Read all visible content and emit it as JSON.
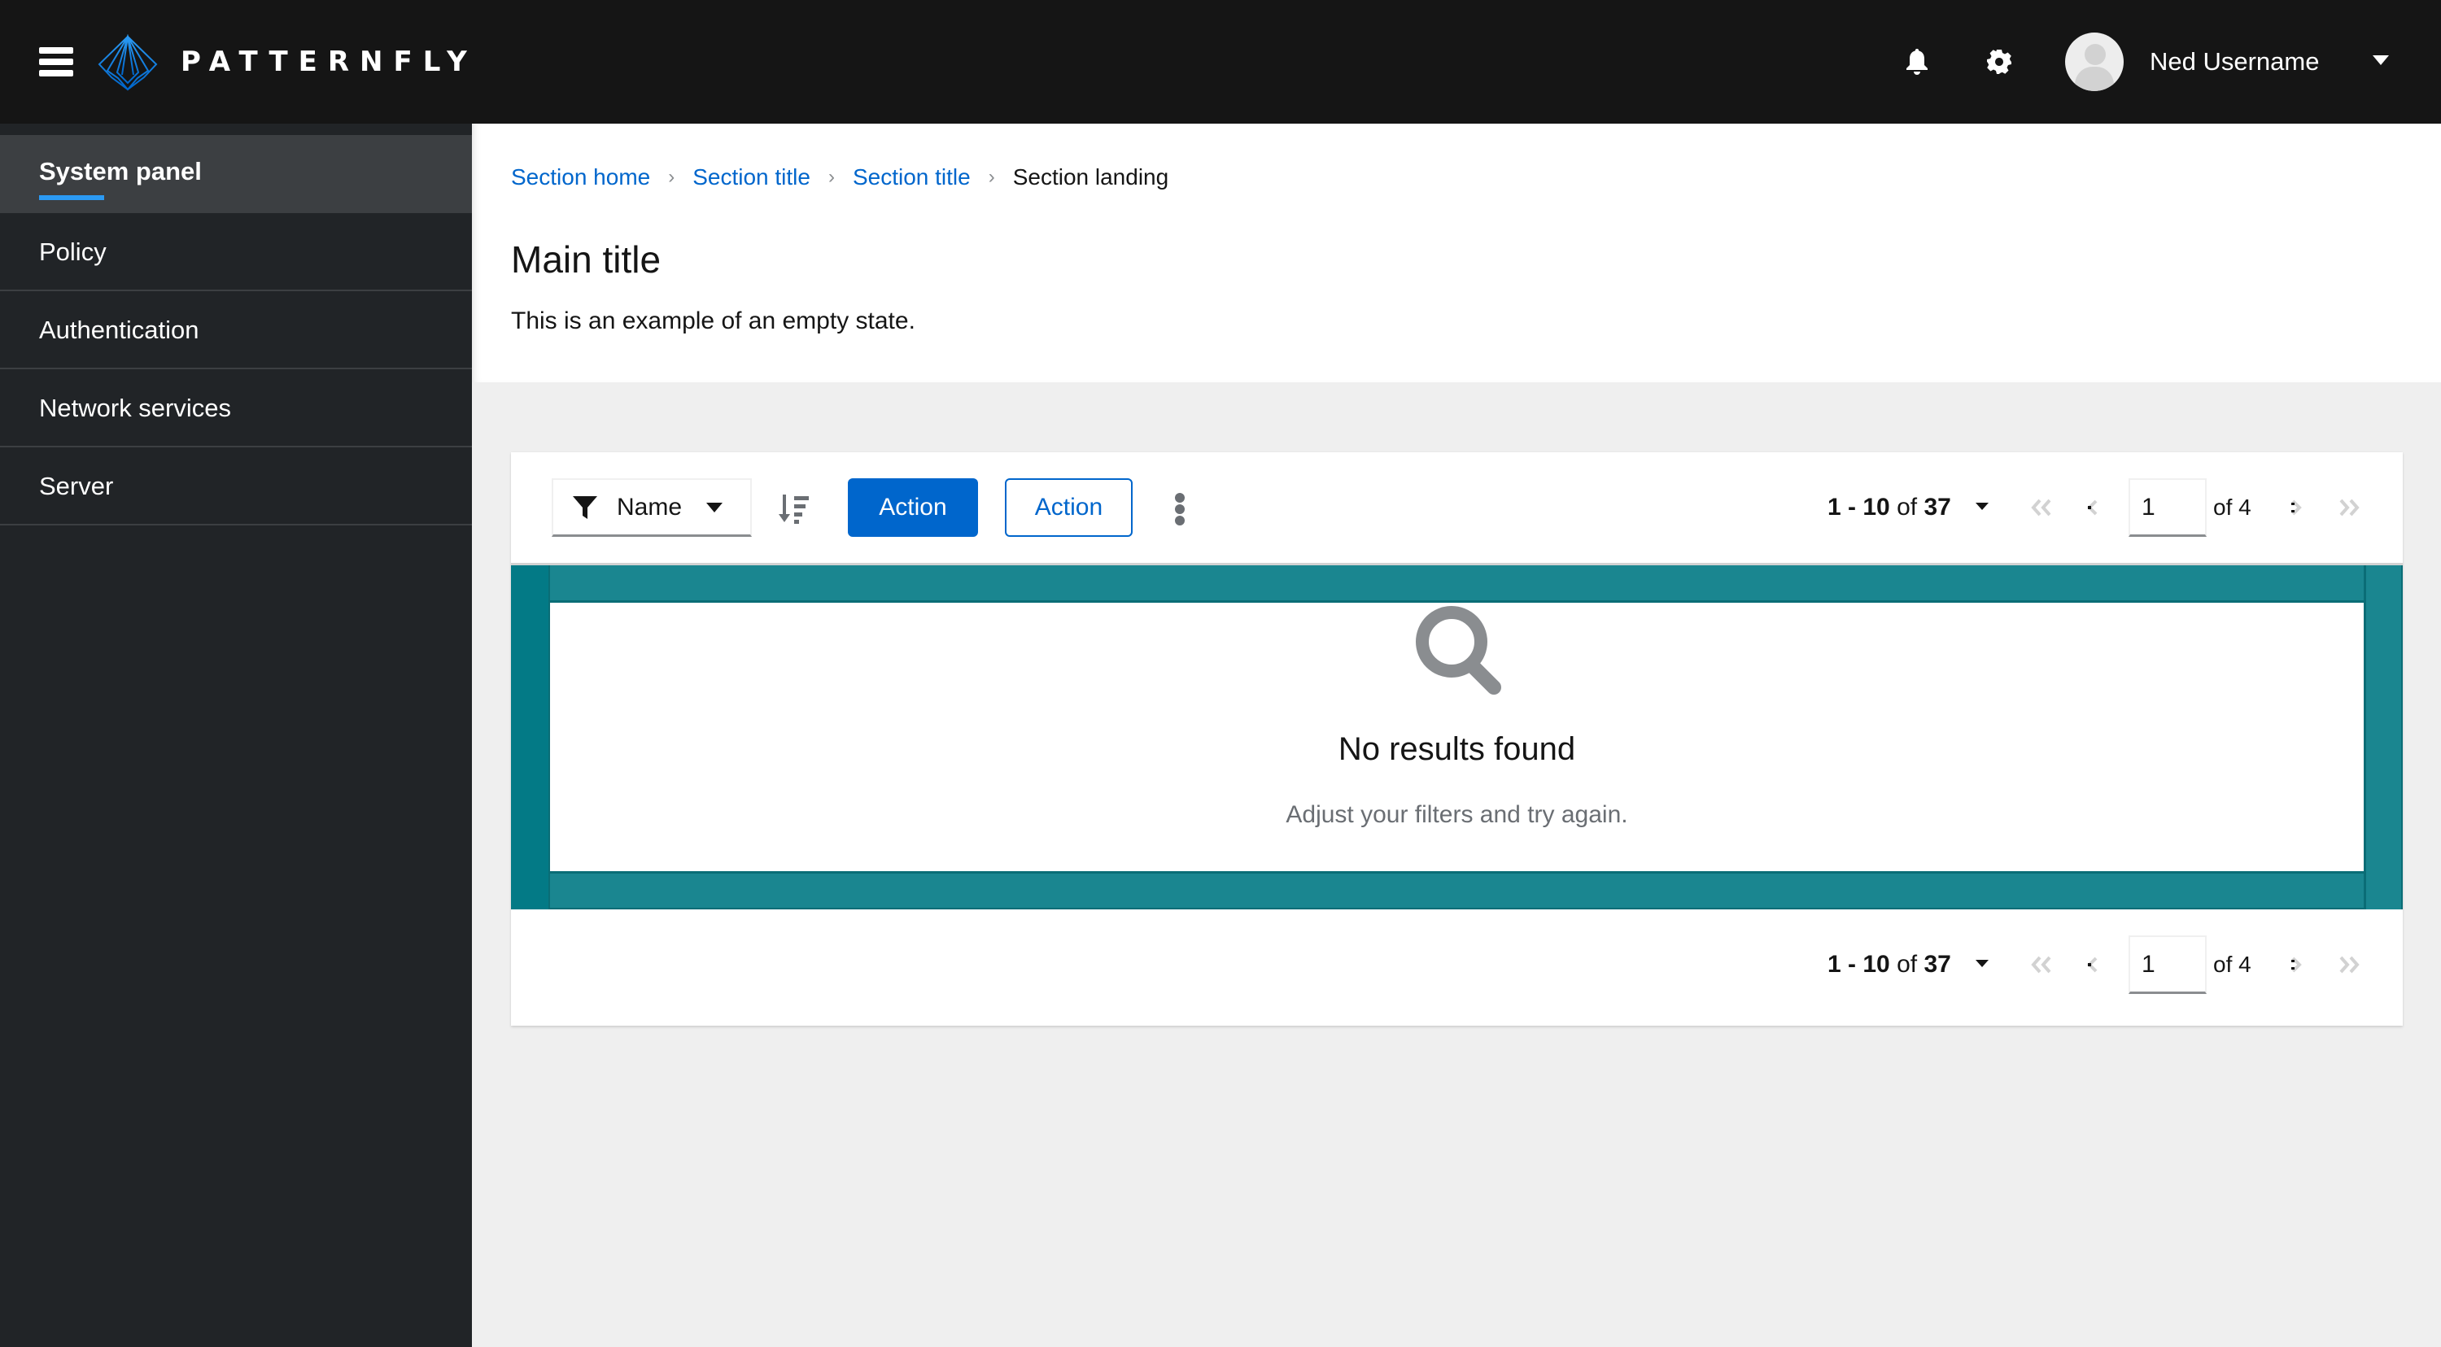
{
  "masthead": {
    "brand": "PATTERNFLY",
    "icons": {
      "menu": "hamburger-icon",
      "logo": "patternfly-logo-icon",
      "notifications": "bell-icon",
      "settings": "gear-icon",
      "avatar": "user-avatar-icon",
      "user_menu": "caret-down-icon"
    },
    "user_name": "Ned Username"
  },
  "sidebar": {
    "items": [
      {
        "label": "System panel",
        "active": true
      },
      {
        "label": "Policy",
        "active": false
      },
      {
        "label": "Authentication",
        "active": false
      },
      {
        "label": "Network services",
        "active": false
      },
      {
        "label": "Server",
        "active": false
      }
    ]
  },
  "breadcrumb": {
    "items": [
      {
        "label": "Section home",
        "link": true
      },
      {
        "label": "Section title",
        "link": true
      },
      {
        "label": "Section title",
        "link": true
      },
      {
        "label": "Section landing",
        "link": false
      }
    ]
  },
  "page": {
    "title": "Main title",
    "description": "This is an example of an empty state."
  },
  "toolbar": {
    "filter_label": "Name",
    "filter_icon": "filter-icon",
    "sort_icon": "sort-amount-down-icon",
    "primary_action": "Action",
    "secondary_action": "Action",
    "kebab_icon": "kebab-icon"
  },
  "pagination": {
    "range": "1 - 10",
    "of_label": "of",
    "total": "37",
    "current_page": "1",
    "pages_label": "of 4"
  },
  "empty_state": {
    "icon": "search-icon",
    "title": "No results found",
    "body": "Adjust your filters and try again."
  },
  "colors": {
    "masthead_bg": "#151515",
    "sidebar_bg": "#212427",
    "sidebar_active_bg": "#3c3f42",
    "active_indicator": "#2b9af3",
    "primary": "#0066cc",
    "teal_frame": "#1a8690",
    "teal_frame_dark": "#037a86",
    "page_bg": "#efefef"
  }
}
